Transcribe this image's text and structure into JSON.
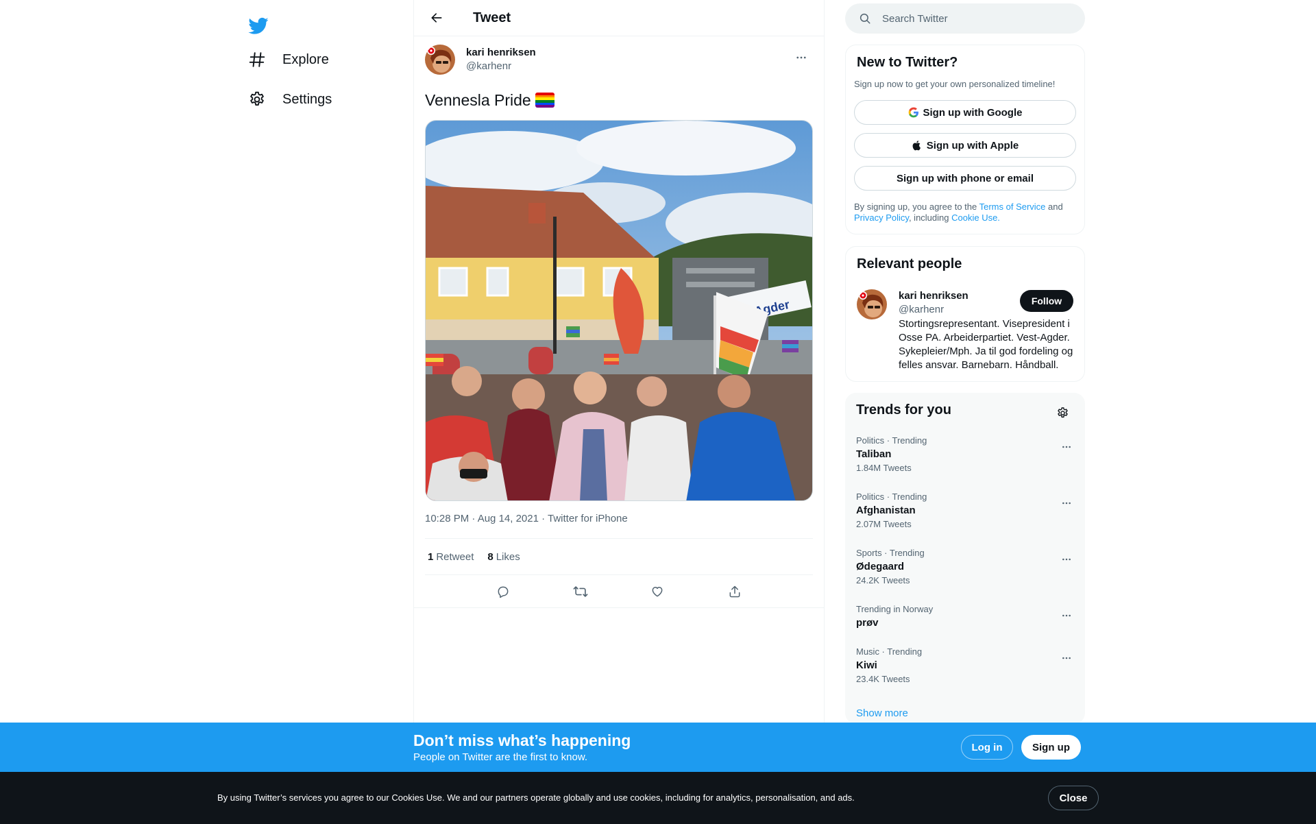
{
  "nav": {
    "logo": "twitter-bird-icon",
    "explore": "Explore",
    "settings": "Settings"
  },
  "header": {
    "title": "Tweet"
  },
  "tweet": {
    "display_name": "kari henriksen",
    "handle": "@karhenr",
    "text": "Vennesla Pride",
    "emoji": "rainbow-flag",
    "meta": "10:28 PM · Aug 14, 2021 · Twitter for iPhone",
    "retweets_count": "1",
    "retweets_label": "Retweet",
    "likes_count": "8",
    "likes_label": "Likes",
    "photo_sign_text": "fri. Agder"
  },
  "search": {
    "placeholder": "Search Twitter"
  },
  "signup_card": {
    "title": "New to Twitter?",
    "subtitle": "Sign up now to get your own personalized timeline!",
    "google": "Sign up with Google",
    "apple": "Sign up with Apple",
    "phone": "Sign up with phone or email",
    "legal_1": "By signing up, you agree to the ",
    "tos": "Terms of Service",
    "legal_2": " and ",
    "privacy": "Privacy Policy",
    "legal_3": ", including ",
    "cookie": "Cookie Use."
  },
  "relevant": {
    "title": "Relevant people",
    "name": "kari henriksen",
    "handle": "@karhenr",
    "follow": "Follow",
    "bio": "Stortingsrepresentant. Visepresident i Osse PA. Arbeiderpartiet. Vest-Agder. Sykepleier/Mph. Ja til god fordeling og felles ansvar. Barnebarn. Håndball."
  },
  "trends": {
    "title": "Trends for you",
    "items": [
      {
        "context": "Politics · Trending",
        "name": "Taliban",
        "count": "1.84M Tweets"
      },
      {
        "context": "Politics · Trending",
        "name": "Afghanistan",
        "count": "2.07M Tweets"
      },
      {
        "context": "Sports · Trending",
        "name": "Ødegaard",
        "count": "24.2K Tweets"
      },
      {
        "context": "Trending in Norway",
        "name": "prøv",
        "count": ""
      },
      {
        "context": "Music · Trending",
        "name": "Kiwi",
        "count": "23.4K Tweets"
      }
    ],
    "show_more": "Show more"
  },
  "banner": {
    "title": "Don’t miss what’s happening",
    "subtitle": "People on Twitter are the first to know.",
    "login": "Log in",
    "signup": "Sign up"
  },
  "cookie": {
    "text": "By using Twitter’s services you agree to our Cookies Use. We and our partners operate globally and use cookies, including for analytics, personalisation, and ads.",
    "close": "Close"
  },
  "colors": {
    "accent": "#1d9bf0",
    "text": "#0f1419",
    "secondary": "#536471",
    "cookie_bg": "#0f1419"
  }
}
